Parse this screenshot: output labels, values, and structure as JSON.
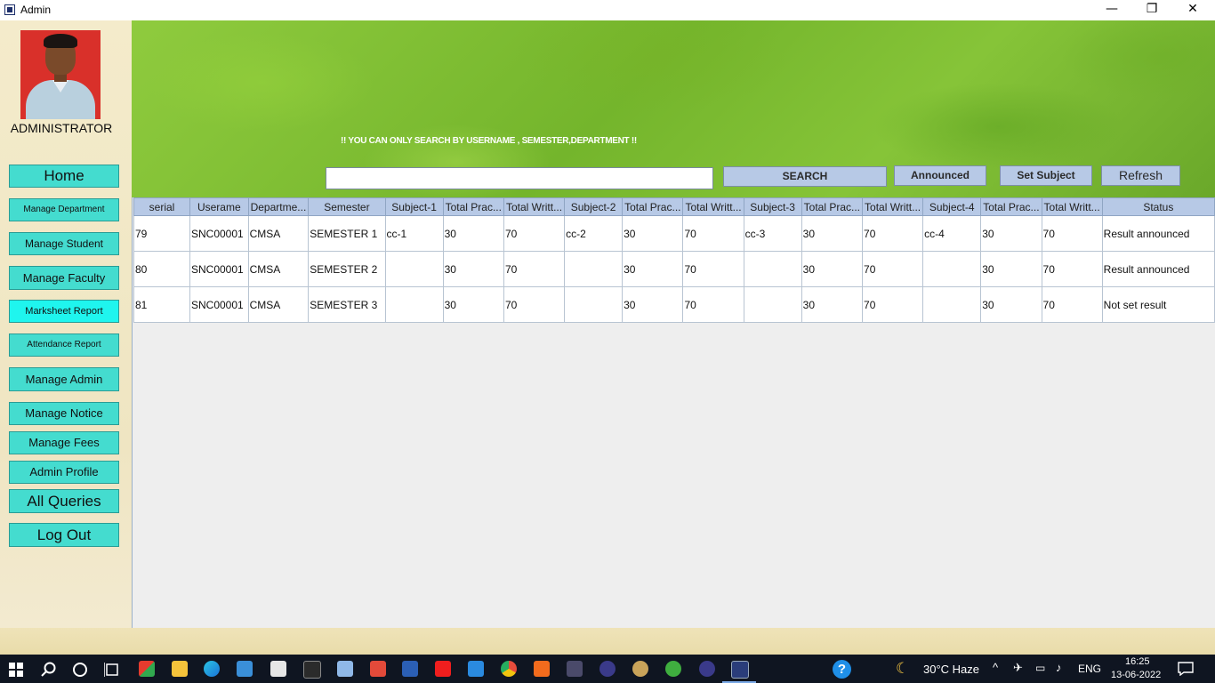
{
  "window": {
    "title": "Admin",
    "minimize": "—",
    "restore": "❐",
    "close": "✕"
  },
  "sidebar": {
    "role": "ADMINISTRATOR",
    "items": [
      {
        "label": "Home"
      },
      {
        "label": "Manage Department"
      },
      {
        "label": "Manage Student"
      },
      {
        "label": "Manage Faculty"
      },
      {
        "label": "Marksheet Report"
      },
      {
        "label": "Attendance Report"
      },
      {
        "label": "Manage Admin"
      },
      {
        "label": "Manage Notice"
      },
      {
        "label": "Manage Fees"
      },
      {
        "label": "Admin Profile"
      },
      {
        "label": "All Queries"
      },
      {
        "label": "Log Out"
      }
    ]
  },
  "header": {
    "notice": "!! YOU CAN ONLY SEARCH BY USERNAME , SEMESTER,DEPARTMENT !!",
    "search_value": "",
    "buttons": {
      "search": "SEARCH",
      "announced": "Announced",
      "set_subject": "Set Subject",
      "refresh": "Refresh"
    }
  },
  "table": {
    "columns": [
      "serial",
      "Userame",
      "Departme...",
      "Semester",
      "Subject-1",
      "Total Prac...",
      "Total Writt...",
      "Subject-2",
      "Total Prac...",
      "Total Writt...",
      "Subject-3",
      "Total Prac...",
      "Total Writt...",
      "Subject-4",
      "Total Prac...",
      "Total Writt...",
      "Status"
    ],
    "rows": [
      [
        "79",
        "SNC00001",
        "CMSA",
        "SEMESTER 1",
        "cc-1",
        "30",
        "70",
        "cc-2",
        "30",
        "70",
        "cc-3",
        "30",
        "70",
        "cc-4",
        "30",
        "70",
        "Result announced"
      ],
      [
        "80",
        "SNC00001",
        "CMSA",
        "SEMESTER 2",
        "",
        "30",
        "70",
        "",
        "30",
        "70",
        "",
        "30",
        "70",
        "",
        "30",
        "70",
        "Result announced"
      ],
      [
        "81",
        "SNC00001",
        "CMSA",
        "SEMESTER 3",
        "",
        "30",
        "70",
        "",
        "30",
        "70",
        "",
        "30",
        "70",
        "",
        "30",
        "70",
        "Not set result"
      ]
    ]
  },
  "taskbar": {
    "weather": "30°C  Haze",
    "language": "ENG",
    "time": "16:25",
    "date": "13-06-2022"
  },
  "colors": {
    "nav_button": "#44dccf",
    "nav_button_active": "#1ff5ee",
    "table_header": "#b7c9e6",
    "banner_green": "#7dbb32"
  }
}
